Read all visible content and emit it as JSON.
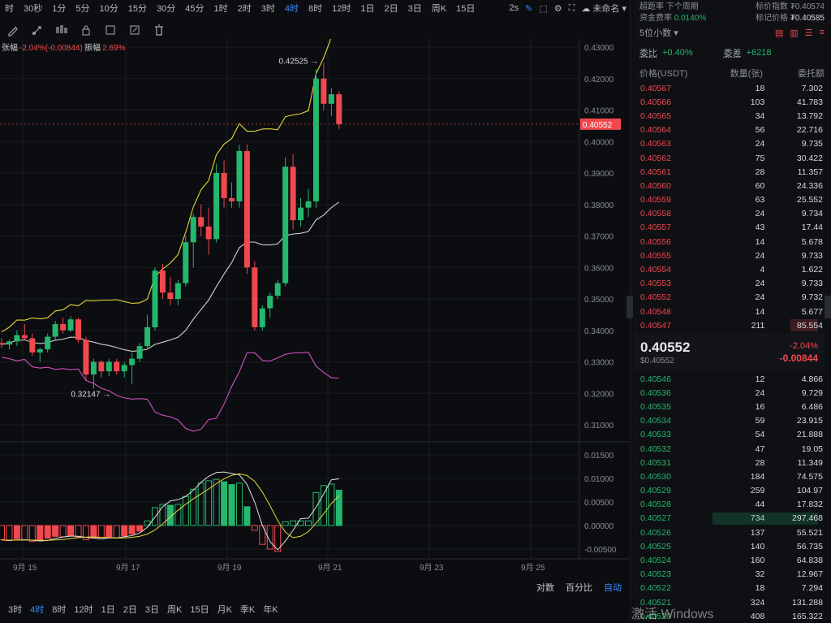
{
  "toolbar": {
    "timeframes": [
      "时",
      "30秒",
      "1分",
      "5分",
      "10分",
      "15分",
      "30分",
      "45分",
      "1时",
      "2时",
      "3时",
      "4时",
      "8时",
      "12时",
      "1日",
      "2日",
      "3日",
      "周K",
      "15日"
    ],
    "active": "4时",
    "right": {
      "refresh": "2s",
      "layout": "未命名"
    }
  },
  "indicator": {
    "change_label": "张幅",
    "change_value": "-2.04%(-0.00844)",
    "amp_label": "振幅",
    "amp_value": "2.69%"
  },
  "chart_data": {
    "type": "candlestick",
    "x_labels": [
      "9月 15",
      "9月 17",
      "9月 19",
      "9月 21",
      "9月 23",
      "9月 25"
    ],
    "price_ticks": [
      "0.43000",
      "0.42000",
      "0.41000",
      "0.40000",
      "0.39000",
      "0.38000",
      "0.37000",
      "0.36000",
      "0.35000",
      "0.34000",
      "0.33000",
      "0.32000",
      "0.31000"
    ],
    "macd_ticks": [
      "0.01500",
      "0.01000",
      "0.00500",
      "0.00000",
      "-0.00500"
    ],
    "last_price": "0.40552",
    "high_label": "0.42525 →",
    "low_label": "0.32147 →",
    "candles": [
      [
        0.336,
        0.3375,
        0.3345,
        0.3355
      ],
      [
        0.3355,
        0.337,
        0.334,
        0.3365
      ],
      [
        0.3365,
        0.34,
        0.335,
        0.3385
      ],
      [
        0.3385,
        0.342,
        0.337,
        0.3375
      ],
      [
        0.3375,
        0.339,
        0.332,
        0.333
      ],
      [
        0.333,
        0.3345,
        0.33,
        0.334
      ],
      [
        0.334,
        0.339,
        0.333,
        0.338
      ],
      [
        0.338,
        0.343,
        0.337,
        0.342
      ],
      [
        0.342,
        0.344,
        0.339,
        0.34
      ],
      [
        0.34,
        0.3445,
        0.3395,
        0.3435
      ],
      [
        0.3435,
        0.344,
        0.336,
        0.337
      ],
      [
        0.337,
        0.338,
        0.324,
        0.326
      ],
      [
        0.326,
        0.331,
        0.3215,
        0.33
      ],
      [
        0.33,
        0.3305,
        0.325,
        0.327
      ],
      [
        0.327,
        0.331,
        0.3255,
        0.33
      ],
      [
        0.33,
        0.331,
        0.326,
        0.327
      ],
      [
        0.327,
        0.33,
        0.325,
        0.329
      ],
      [
        0.329,
        0.333,
        0.323,
        0.331
      ],
      [
        0.331,
        0.336,
        0.33,
        0.335
      ],
      [
        0.335,
        0.345,
        0.334,
        0.341
      ],
      [
        0.341,
        0.36,
        0.34,
        0.359
      ],
      [
        0.359,
        0.361,
        0.35,
        0.352
      ],
      [
        0.352,
        0.357,
        0.348,
        0.35
      ],
      [
        0.35,
        0.356,
        0.348,
        0.355
      ],
      [
        0.355,
        0.37,
        0.354,
        0.368
      ],
      [
        0.368,
        0.377,
        0.36,
        0.376
      ],
      [
        0.376,
        0.38,
        0.37,
        0.373
      ],
      [
        0.373,
        0.379,
        0.364,
        0.369
      ],
      [
        0.369,
        0.393,
        0.368,
        0.39
      ],
      [
        0.39,
        0.394,
        0.379,
        0.382
      ],
      [
        0.382,
        0.387,
        0.379,
        0.381
      ],
      [
        0.381,
        0.399,
        0.379,
        0.397
      ],
      [
        0.397,
        0.399,
        0.358,
        0.36
      ],
      [
        0.36,
        0.362,
        0.34,
        0.341
      ],
      [
        0.341,
        0.348,
        0.34,
        0.347
      ],
      [
        0.347,
        0.352,
        0.344,
        0.351
      ],
      [
        0.351,
        0.356,
        0.35,
        0.355
      ],
      [
        0.355,
        0.395,
        0.354,
        0.392
      ],
      [
        0.392,
        0.396,
        0.372,
        0.375
      ],
      [
        0.375,
        0.382,
        0.373,
        0.379
      ],
      [
        0.379,
        0.385,
        0.376,
        0.381
      ],
      [
        0.381,
        0.423,
        0.379,
        0.42
      ],
      [
        0.42,
        0.425,
        0.41,
        0.412
      ],
      [
        0.412,
        0.417,
        0.408,
        0.415
      ],
      [
        0.415,
        0.416,
        0.404,
        0.4055
      ]
    ],
    "macd": [
      -0.003,
      -0.0032,
      -0.0028,
      -0.003,
      -0.0034,
      -0.0032,
      -0.0027,
      -0.0023,
      -0.0024,
      -0.0022,
      -0.0024,
      -0.003,
      -0.0026,
      -0.0028,
      -0.0025,
      -0.0026,
      -0.0022,
      -0.0018,
      -0.0012,
      0.001,
      0.0038,
      0.0045,
      0.0043,
      0.0045,
      0.0062,
      0.0077,
      0.009,
      0.0095,
      0.0098,
      0.0093,
      0.0087,
      0.009,
      0.004,
      -0.001,
      -0.004,
      -0.005,
      -0.0055,
      0.0008,
      0.001,
      0.001,
      0.001,
      0.007,
      0.0085,
      0.0088,
      0.0075
    ]
  },
  "right_panel": {
    "top_left_1": "超距率   下个周期",
    "top_right_1": "标价指数 ₮0.40574",
    "funding_label": "资金费率",
    "funding_value": "0.0140%",
    "mark_label": "标记价格",
    "mark_value": "₮0.40585",
    "precision": "5位小数",
    "ratio_label": "委比",
    "ratio_value": "+0.40%",
    "diff_label": "委差",
    "diff_value": "+6218",
    "headers": [
      "价格(USDT)",
      "数量(张)",
      "委托额"
    ],
    "asks": [
      [
        "0.40567",
        "18",
        "7.302",
        0
      ],
      [
        "0.40566",
        "103",
        "41.783",
        0
      ],
      [
        "0.40565",
        "34",
        "13.792",
        0
      ],
      [
        "0.40564",
        "56",
        "22.716",
        0
      ],
      [
        "0.40563",
        "24",
        "9.735",
        0
      ],
      [
        "0.40562",
        "75",
        "30.422",
        0
      ],
      [
        "0.40561",
        "28",
        "11.357",
        0
      ],
      [
        "0.40560",
        "60",
        "24.336",
        0
      ],
      [
        "0.40559",
        "63",
        "25.552",
        0
      ],
      [
        "0.40558",
        "24",
        "9.734",
        0
      ],
      [
        "0.40557",
        "43",
        "17.44",
        0
      ],
      [
        "0.40556",
        "14",
        "5.678",
        0
      ],
      [
        "0.40555",
        "24",
        "9.733",
        0
      ],
      [
        "0.40554",
        "4",
        "1.622",
        0
      ],
      [
        "0.40553",
        "24",
        "9.733",
        0
      ],
      [
        "0.40552",
        "24",
        "9.732",
        0
      ],
      [
        "0.40548",
        "14",
        "5.677",
        0
      ],
      [
        "0.40547",
        "211",
        "85.554",
        26
      ]
    ],
    "mid_price": "0.40552",
    "mid_sub": "$0.40552",
    "mid_pct": "-2.04%",
    "mid_chg": "-0.00844",
    "bids": [
      [
        "0.40546",
        "12",
        "4.866",
        0
      ],
      [
        "0.40536",
        "24",
        "9.729",
        0
      ],
      [
        "0.40535",
        "16",
        "6.486",
        0
      ],
      [
        "0.40534",
        "59",
        "23.915",
        0
      ],
      [
        "0.40533",
        "54",
        "21.888",
        0
      ],
      [
        "0.40532",
        "47",
        "19.05",
        0
      ],
      [
        "0.40531",
        "28",
        "11.349",
        0
      ],
      [
        "0.40530",
        "184",
        "74.575",
        0
      ],
      [
        "0.40529",
        "259",
        "104.97",
        0
      ],
      [
        "0.40528",
        "44",
        "17.832",
        0
      ],
      [
        "0.40527",
        "734",
        "297.468",
        100
      ],
      [
        "0.40526",
        "137",
        "55.521",
        0
      ],
      [
        "0.40525",
        "140",
        "56.735",
        0
      ],
      [
        "0.40524",
        "160",
        "64.838",
        0
      ],
      [
        "0.40523",
        "32",
        "12.967",
        0
      ],
      [
        "0.40522",
        "18",
        "7.294",
        0
      ],
      [
        "0.40521",
        "324",
        "131.288",
        0
      ],
      [
        "0.40520",
        "408",
        "165.322",
        0
      ]
    ]
  },
  "bottom": {
    "log": "对数",
    "percent": "百分比",
    "auto": "自动"
  },
  "bottom_timeframes": [
    "3时",
    "4时",
    "8时",
    "12时",
    "1日",
    "2日",
    "3日",
    "周K",
    "15日",
    "月K",
    "季K",
    "年K"
  ],
  "bottom_active": "4时",
  "watermark": "激活 Windows"
}
